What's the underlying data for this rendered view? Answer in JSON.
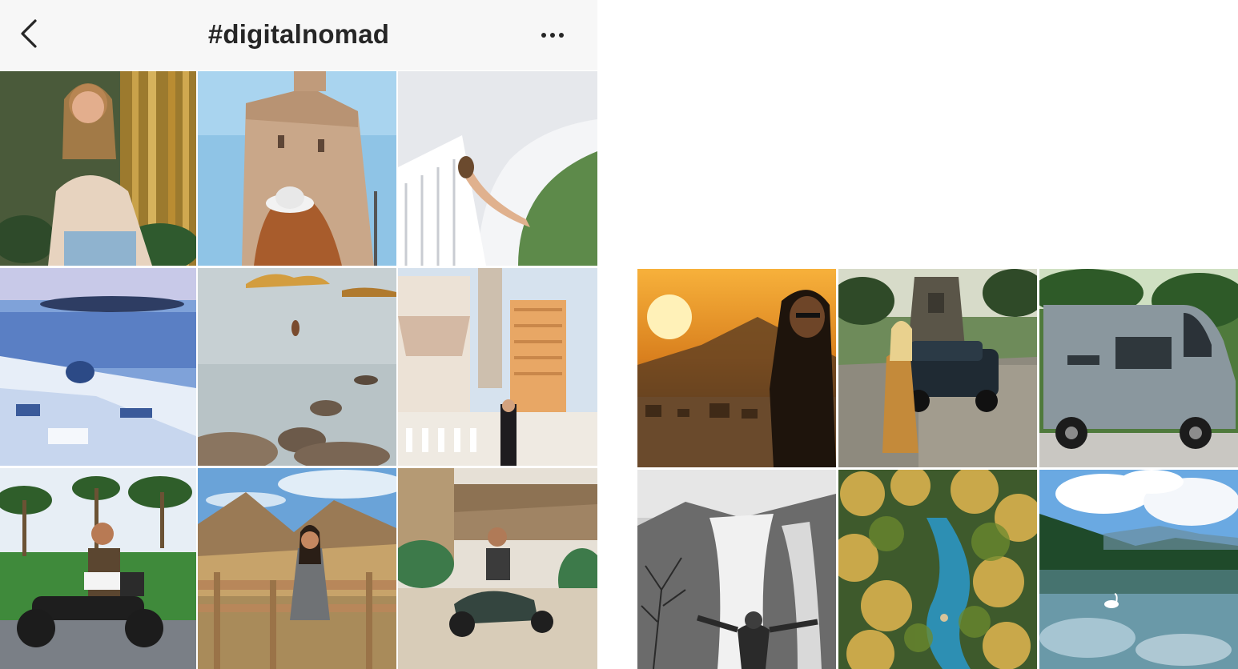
{
  "header": {
    "title": "#digitalnomad",
    "back_icon": "chevron-left-icon",
    "more_icon": "more-horizontal-icon"
  },
  "left_grid": [
    {
      "name": "portrait-bamboo-tile"
    },
    {
      "name": "tower-hat-tile"
    },
    {
      "name": "curved-building-tile"
    },
    {
      "name": "santorini-tile"
    },
    {
      "name": "sea-rocks-tile"
    },
    {
      "name": "venetian-tile"
    },
    {
      "name": "scooter-palms-tile"
    },
    {
      "name": "mountains-fence-tile"
    },
    {
      "name": "vespa-cafe-tile"
    }
  ],
  "right_grid": [
    {
      "name": "sunset-city-tile"
    },
    {
      "name": "classic-car-temple-tile"
    },
    {
      "name": "campervan-tile"
    },
    {
      "name": "waterfall-tile"
    },
    {
      "name": "palm-river-tile"
    },
    {
      "name": "lake-swan-tile"
    }
  ]
}
